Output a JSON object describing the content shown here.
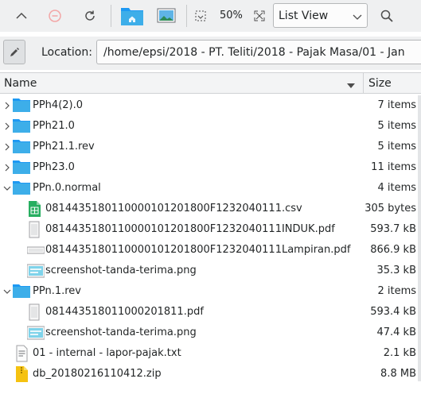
{
  "toolbar": {
    "zoom": "50%",
    "view_mode": "List View",
    "buttons": [
      "up-icon",
      "stop-icon",
      "reload-icon",
      "home-icon",
      "preview-icon",
      "zoom-out-icon",
      "zoom-in-icon",
      "search-icon"
    ]
  },
  "location": {
    "label": "Location:",
    "path": "/home/epsi/2018 - PT. Teliti/2018 - Pajak Masa/01 - Jan"
  },
  "columns": {
    "name": "Name",
    "size": "Size"
  },
  "colors": {
    "folder": "#3daee9",
    "folder_dark": "#1d99f3",
    "toolbar_bg": "#eff0f1",
    "spreadsheet": "#27ae60",
    "zip": "#f5c211"
  },
  "files": [
    {
      "name": "PPh4(2).0",
      "size": "7 items",
      "icon": "folder",
      "depth": 0,
      "expand": "collapsed"
    },
    {
      "name": "PPh21.0",
      "size": "5 items",
      "icon": "folder",
      "depth": 0,
      "expand": "collapsed"
    },
    {
      "name": "PPh21.1.rev",
      "size": "5 items",
      "icon": "folder",
      "depth": 0,
      "expand": "collapsed"
    },
    {
      "name": "PPh23.0",
      "size": "11 items",
      "icon": "folder",
      "depth": 0,
      "expand": "collapsed"
    },
    {
      "name": "PPn.0.normal",
      "size": "4 items",
      "icon": "folder",
      "depth": 0,
      "expand": "expanded"
    },
    {
      "name": "081443518011000010120180​0F1232040111.csv",
      "size": "305 bytes",
      "icon": "csv",
      "depth": 1,
      "expand": "none"
    },
    {
      "name": "0814435180110000101201800F1232040111INDUK.pdf",
      "size": "593.7 kB",
      "icon": "pdf",
      "depth": 1,
      "expand": "none"
    },
    {
      "name": "0814435180110000101201800F1232040111Lampiran.pdf",
      "size": "866.9 kB",
      "icon": "pdf-wide",
      "depth": 1,
      "expand": "none"
    },
    {
      "name": "screenshot-tanda-terima.png",
      "size": "35.3 kB",
      "icon": "image",
      "depth": 1,
      "expand": "none"
    },
    {
      "name": "PPn.1.rev",
      "size": "2 items",
      "icon": "folder",
      "depth": 0,
      "expand": "expanded"
    },
    {
      "name": "081443518011000201811.pdf",
      "size": "593.4 kB",
      "icon": "pdf",
      "depth": 1,
      "expand": "none"
    },
    {
      "name": "screenshot-tanda-terima.png",
      "size": "47.4 kB",
      "icon": "image",
      "depth": 1,
      "expand": "none"
    },
    {
      "name": "01 - internal - lapor-pajak.txt",
      "size": "2.1 kB",
      "icon": "text",
      "depth": 0,
      "expand": "none"
    },
    {
      "name": "db_20180216110412.zip",
      "size": "8.8 MB",
      "icon": "zip",
      "depth": 0,
      "expand": "none"
    }
  ]
}
